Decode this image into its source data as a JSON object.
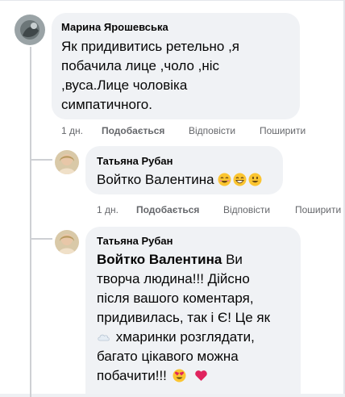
{
  "comments": [
    {
      "author": "Марина Ярошевська",
      "lines": [
        "Як придивитись ретельно ,я",
        "побачила лице ,чоло ,ніс",
        ",вуса.Лице чоловіка",
        "симпатичного."
      ],
      "time": "1 дн.",
      "like": "Подобається",
      "reply": "Відповісти",
      "share": "Поширити"
    },
    {
      "author": "Татьяна Рубан",
      "text": "Войтко Валентина",
      "emojis": [
        "smiling-face-icon",
        "grinning-face-icon",
        "smiley-face-icon"
      ],
      "time": "1 дн.",
      "like": "Подобається",
      "reply": "Відповісти",
      "share": "Поширити"
    },
    {
      "author": "Татьяна Рубан",
      "mention": "Войтко Валентина",
      "line1_rest": " Ви",
      "line2": "творча людина!!! Дійсно",
      "line3": "після вашого коментаря,",
      "line4": "придивилась, так і Є! Це як",
      "line5_rest": " хмаринки розглядати,",
      "line6": "багато цікавого можна",
      "line7": "побачити!!!",
      "inline_emoji": "cloud-icon",
      "end_emojis": [
        "heart-eyes-icon",
        "red-heart-icon"
      ]
    }
  ]
}
